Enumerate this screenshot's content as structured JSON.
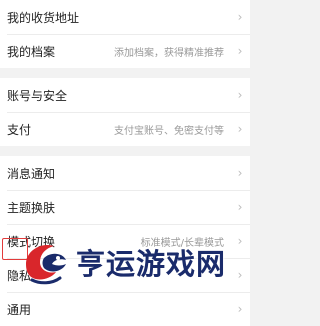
{
  "settings": {
    "group1": [
      {
        "label": "我的收货地址",
        "sub": ""
      },
      {
        "label": "我的档案",
        "sub": "添加档案，获得精准推荐"
      }
    ],
    "group2": [
      {
        "label": "账号与安全",
        "sub": ""
      },
      {
        "label": "支付",
        "sub": "支付宝账号、免密支付等"
      }
    ],
    "group3": [
      {
        "label": "消息通知",
        "sub": ""
      },
      {
        "label": "主题换肤",
        "sub": ""
      },
      {
        "label": "模式切换",
        "sub": "标准模式/长辈模式"
      },
      {
        "label": "隐私",
        "sub": ""
      },
      {
        "label": "通用",
        "sub": ""
      }
    ]
  },
  "watermark": {
    "text": "亨运游戏网",
    "colors": {
      "red": "#d9262b",
      "navy": "#1a2b6b",
      "highlight": "#e23b3b"
    }
  }
}
